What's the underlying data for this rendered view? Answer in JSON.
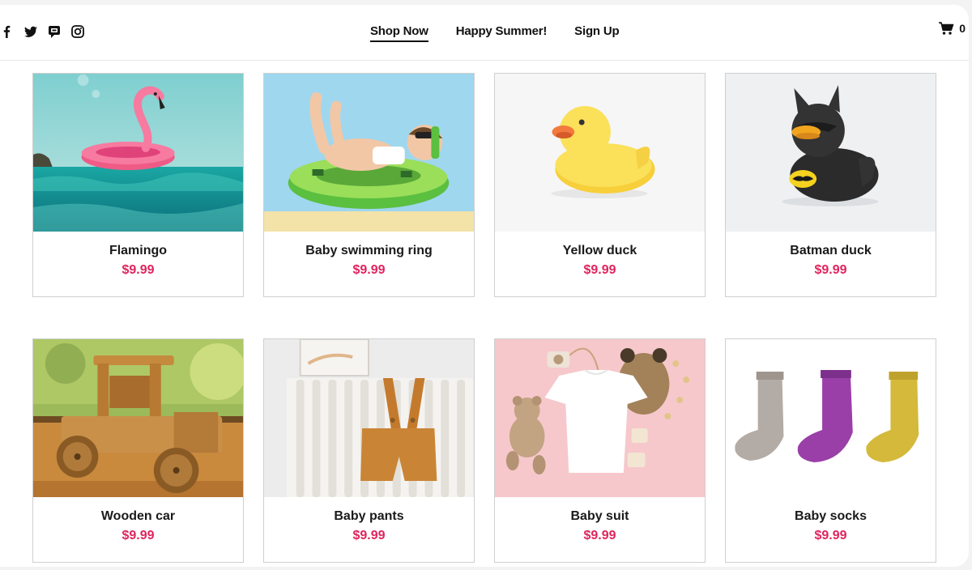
{
  "social": {
    "icons": [
      "facebook-icon",
      "twitter-icon",
      "messenger-icon",
      "instagram-icon"
    ]
  },
  "nav": {
    "items": [
      {
        "label": "Shop Now",
        "active": true
      },
      {
        "label": "Happy Summer!",
        "active": false
      },
      {
        "label": "Sign Up",
        "active": false
      }
    ]
  },
  "cart": {
    "icon": "cart-icon",
    "count": "0"
  },
  "colors": {
    "price": "#e0245e",
    "text": "#1a1a1a",
    "border": "#cfcfcf"
  },
  "products": [
    {
      "name": "Flamingo",
      "price": "$9.99",
      "image": "flamingo-float-image"
    },
    {
      "name": "Baby swimming ring",
      "price": "$9.99",
      "image": "baby-swim-ring-image"
    },
    {
      "name": "Yellow duck",
      "price": "$9.99",
      "image": "yellow-duck-image"
    },
    {
      "name": "Batman duck",
      "price": "$9.99",
      "image": "batman-duck-image"
    },
    {
      "name": "Wooden car",
      "price": "$9.99",
      "image": "wooden-car-image"
    },
    {
      "name": "Baby pants",
      "price": "$9.99",
      "image": "baby-pants-image"
    },
    {
      "name": "Baby suit",
      "price": "$9.99",
      "image": "baby-suit-image"
    },
    {
      "name": "Baby socks",
      "price": "$9.99",
      "image": "baby-socks-image"
    }
  ]
}
